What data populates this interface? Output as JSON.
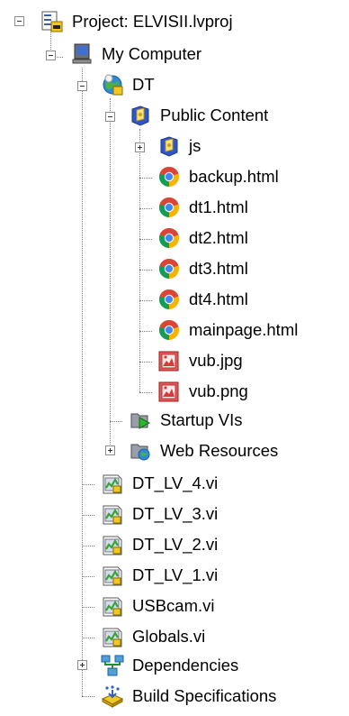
{
  "tree": {
    "project": {
      "label": "Project: ELVISII.lvproj",
      "icon": "project-icon"
    },
    "my_computer": {
      "label": "My Computer",
      "icon": "computer-icon"
    },
    "dt": {
      "label": "DT",
      "icon": "web-service-icon"
    },
    "public_content": {
      "label": "Public Content",
      "icon": "public-folder-icon"
    },
    "js": {
      "label": "js",
      "icon": "public-folder-icon"
    },
    "files": [
      {
        "label": "backup.html",
        "icon": "chrome-html-icon"
      },
      {
        "label": "dt1.html",
        "icon": "chrome-html-icon"
      },
      {
        "label": "dt2.html",
        "icon": "chrome-html-icon"
      },
      {
        "label": "dt3.html",
        "icon": "chrome-html-icon"
      },
      {
        "label": "dt4.html",
        "icon": "chrome-html-icon"
      },
      {
        "label": "mainpage.html",
        "icon": "chrome-html-icon"
      },
      {
        "label": "vub.jpg",
        "icon": "image-file-icon"
      },
      {
        "label": "vub.png",
        "icon": "image-file-icon"
      }
    ],
    "startup_vis": {
      "label": "Startup VIs",
      "icon": "startup-folder-icon"
    },
    "web_resources": {
      "label": "Web Resources",
      "icon": "web-folder-icon"
    },
    "vis": [
      {
        "label": "DT_LV_4.vi",
        "icon": "vi-file-icon"
      },
      {
        "label": "DT_LV_3.vi",
        "icon": "vi-file-icon"
      },
      {
        "label": "DT_LV_2.vi",
        "icon": "vi-file-icon"
      },
      {
        "label": "DT_LV_1.vi",
        "icon": "vi-file-icon"
      },
      {
        "label": "USBcam.vi",
        "icon": "vi-file-icon"
      },
      {
        "label": "Globals.vi",
        "icon": "vi-file-icon"
      }
    ],
    "dependencies": {
      "label": "Dependencies",
      "icon": "dependencies-icon"
    },
    "build_specs": {
      "label": "Build Specifications",
      "icon": "build-specifications-icon"
    }
  },
  "colors": {
    "chrome_red": "#db4437",
    "chrome_yellow": "#f4b400",
    "chrome_green": "#0f9d58",
    "chrome_blue": "#4285f4",
    "folder_blue": "#2f56c8",
    "vi_green": "#3aa43a",
    "image_red": "#d73a3a"
  }
}
